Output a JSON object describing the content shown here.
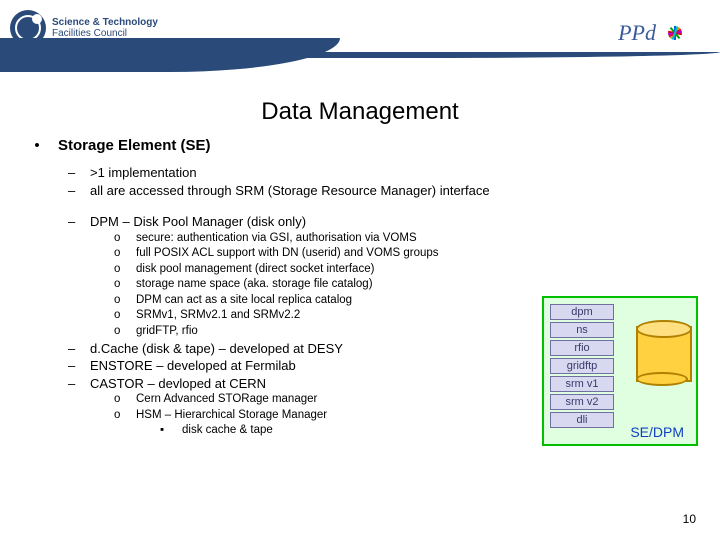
{
  "header": {
    "stfc_line1": "Science & Technology",
    "stfc_line2": "Facilities Council",
    "ppd": "PPd"
  },
  "title": "Data Management",
  "bullets": {
    "lvl1": "Storage Element (SE)",
    "dash1": ">1 implementation",
    "dash2": "all are accessed through SRM (Storage Resource Manager) interface",
    "dash3": "DPM – Disk Pool Manager (disk only)",
    "dpm": [
      "secure: authentication via GSI, authorisation via VOMS",
      "full POSIX ACL support with DN (userid) and VOMS groups",
      "disk pool management (direct socket interface)",
      "storage name space (aka. storage file catalog)",
      "DPM can act as a site local replica catalog",
      "SRMv1, SRMv2.1 and SRMv2.2",
      "gridFTP, rfio"
    ],
    "dash4": "d.Cache (disk & tape) – developed at DESY",
    "dash5": "ENSTORE – developed at Fermilab",
    "dash6": "CASTOR – devloped at CERN",
    "castor": [
      "Cern Advanced STORage manager",
      "HSM – Hierarchical Storage Manager"
    ],
    "castor_sub": "disk cache & tape"
  },
  "diagram": {
    "boxes": [
      "dpm",
      "ns",
      "rfio",
      "gridftp",
      "srm v1",
      "srm v2",
      "dli"
    ],
    "label": "SE/DPM"
  },
  "page_number": "10"
}
